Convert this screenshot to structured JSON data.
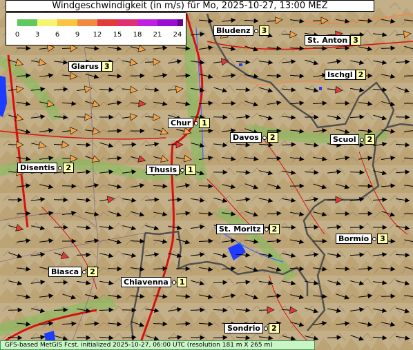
{
  "title": "Windgeschwindigkeit (in m/s) für Mo, 2025-10-27, 13:00 MEZ",
  "legend": {
    "ticks": [
      "0",
      "3",
      "6",
      "9",
      "12",
      "15",
      "18",
      "21",
      "24"
    ],
    "colors": [
      "#5fc85f",
      "#f5f570",
      "#f7c540",
      "#f08a40",
      "#e43a3a",
      "#e03070",
      "#c020e0",
      "#9a10d0",
      "#6a0090"
    ]
  },
  "footer": "GFS-based MetGIS Fcst. initialized 2025-10-27, 06:00 UTC (resolution 181 m X 265 m)",
  "places": [
    {
      "name": "Bludenz",
      "value": "3"
    },
    {
      "name": "St. Anton",
      "value": "3"
    },
    {
      "name": "Glarus",
      "value": "3"
    },
    {
      "name": "Ischgl",
      "value": "2"
    },
    {
      "name": "Chur",
      "value": "1"
    },
    {
      "name": "Davos",
      "value": "2"
    },
    {
      "name": "Scuol",
      "value": "2"
    },
    {
      "name": "Disentis",
      "value": "2"
    },
    {
      "name": "Thusis",
      "value": "1"
    },
    {
      "name": "St. Moritz",
      "value": "2"
    },
    {
      "name": "Bormio",
      "value": "3"
    },
    {
      "name": "Biasca",
      "value": "2"
    },
    {
      "name": "Chiavenna",
      "value": "1"
    },
    {
      "name": "Sondrio",
      "value": "2"
    }
  ]
}
